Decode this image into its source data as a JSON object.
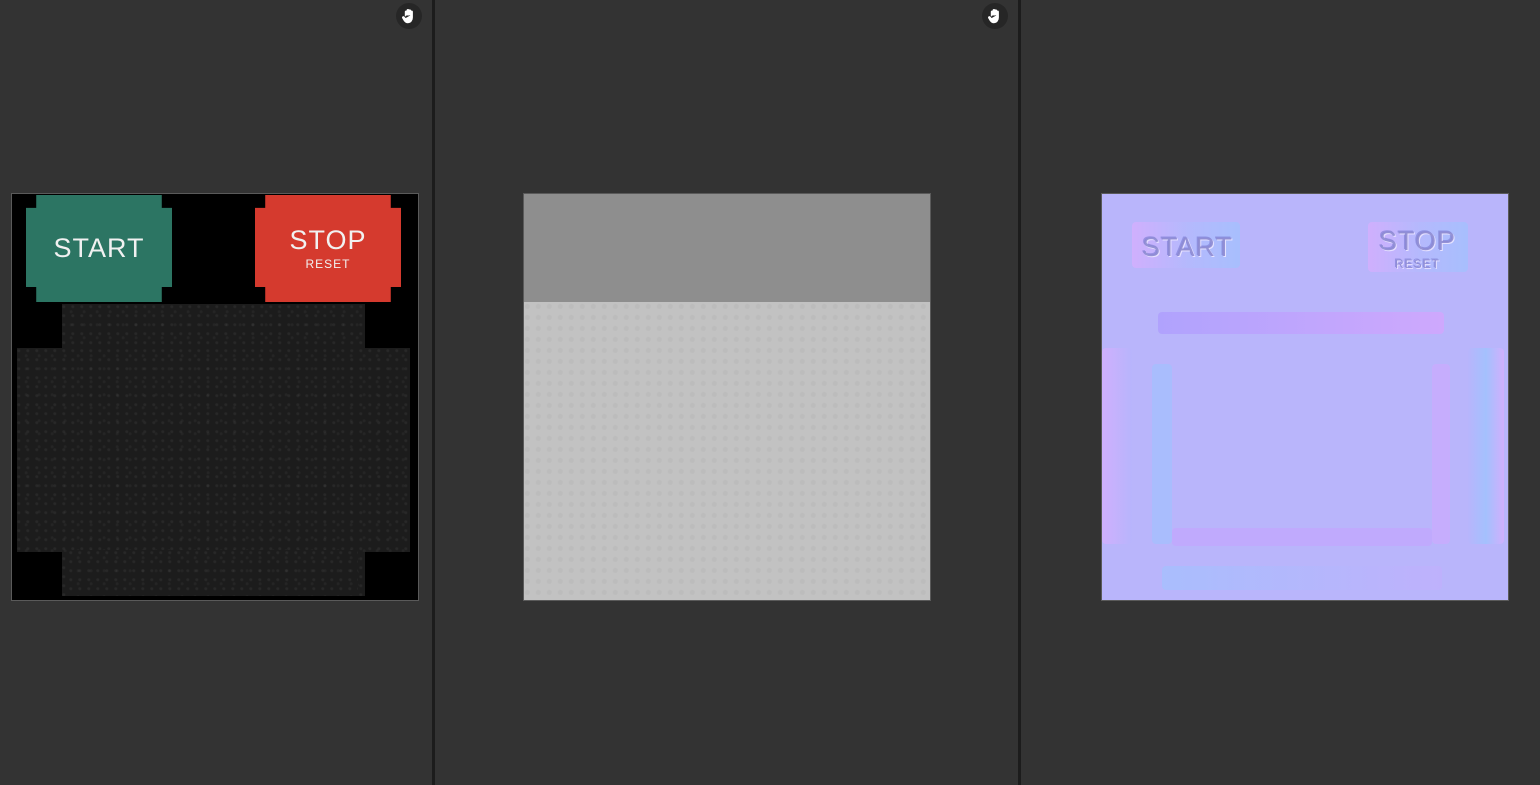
{
  "viewer": {
    "background": "#333333",
    "pan_tool_icon": "hand-pan-icon"
  },
  "textures": {
    "base_color": {
      "start_label": "START",
      "stop_label": "STOP",
      "reset_label": "RESET",
      "start_color": "#2c7563",
      "stop_color": "#d53a2e",
      "body_color": "#1c1c1c"
    },
    "roughness": {
      "top_band_color": "#8e8e8e",
      "bottom_color": "#c2c2c2"
    },
    "normal": {
      "start_label": "START",
      "stop_label": "STOP",
      "reset_label": "RESET",
      "base_color": "#b9b5fb"
    }
  }
}
